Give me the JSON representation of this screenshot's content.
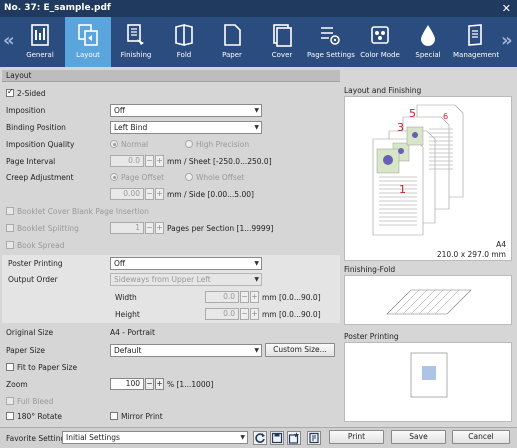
{
  "window": {
    "title": "No. 37: E_sample.pdf",
    "close": "✕"
  },
  "toolbar": {
    "left_arrow": "«",
    "right_arrow": "»",
    "tabs": [
      {
        "label": "General"
      },
      {
        "label": "Layout"
      },
      {
        "label": "Finishing"
      },
      {
        "label": "Fold"
      },
      {
        "label": "Paper"
      },
      {
        "label": "Cover"
      },
      {
        "label": "Page Settings"
      },
      {
        "label": "Color Mode"
      },
      {
        "label": "Special"
      },
      {
        "label": "Management"
      }
    ]
  },
  "layout": {
    "section_title": "Layout",
    "two_sided": "2-Sided",
    "imposition_label": "Imposition",
    "imposition_value": "Off",
    "binding_label": "Binding Position",
    "binding_value": "Left Bind",
    "quality_label": "Imposition Quality",
    "quality_normal": "Normal",
    "quality_high": "High Precision",
    "interval_label": "Page Interval",
    "interval_value": "0.0",
    "interval_unit": "mm / Sheet [-250.0...250.0]",
    "creep_label": "Creep Adjustment",
    "creep_page": "Page Offset",
    "creep_whole": "Whole Offset",
    "creep_value": "0.00",
    "creep_unit": "mm / Side [0.00...5.00]",
    "booklet_cover": "Booklet Cover Blank Page Insertion",
    "booklet_split": "Booklet Splitting",
    "split_value": "1",
    "split_unit": "Pages per Section [1...9999]",
    "book_spread": "Book Spread",
    "spin_minus": "−",
    "spin_plus": "+"
  },
  "poster": {
    "label": "Poster Printing",
    "value": "Off",
    "order_label": "Output Order",
    "order_value": "Sideways from Upper Left",
    "width_label": "Width",
    "width_value": "0.0",
    "width_unit": "mm [0.0...90.0]",
    "height_label": "Height",
    "height_value": "0.0",
    "height_unit": "mm [0.0...90.0]"
  },
  "paper": {
    "original_label": "Original Size",
    "original_value": "A4 - Portrait",
    "size_label": "Paper Size",
    "size_value": "Default",
    "custom_button": "Custom Size...",
    "fit": "Fit to Paper Size",
    "zoom_label": "Zoom",
    "zoom_value": "100",
    "zoom_unit": "% [1...1000]",
    "full_bleed": "Full Bleed",
    "rotate": "180° Rotate",
    "mirror": "Mirror Print"
  },
  "preview": {
    "layout_title": "Layout and Finishing",
    "paper_size": "A4",
    "paper_dims": "210.0 x 297.0 mm",
    "page_numbers": [
      "1",
      "3",
      "5",
      "6"
    ],
    "fold_title": "Finishing-Fold",
    "poster_title": "Poster Printing"
  },
  "bottom": {
    "favorite_label": "Favorite Setting",
    "favorite_value": "Initial Settings",
    "print": "Print",
    "save": "Save",
    "cancel": "Cancel"
  },
  "colors": {
    "title_bg": "#1f3a5e",
    "toolbar_bg": "#2b4c7e",
    "active_tab": "#5aa5dc",
    "page_number": "#c0242b"
  }
}
